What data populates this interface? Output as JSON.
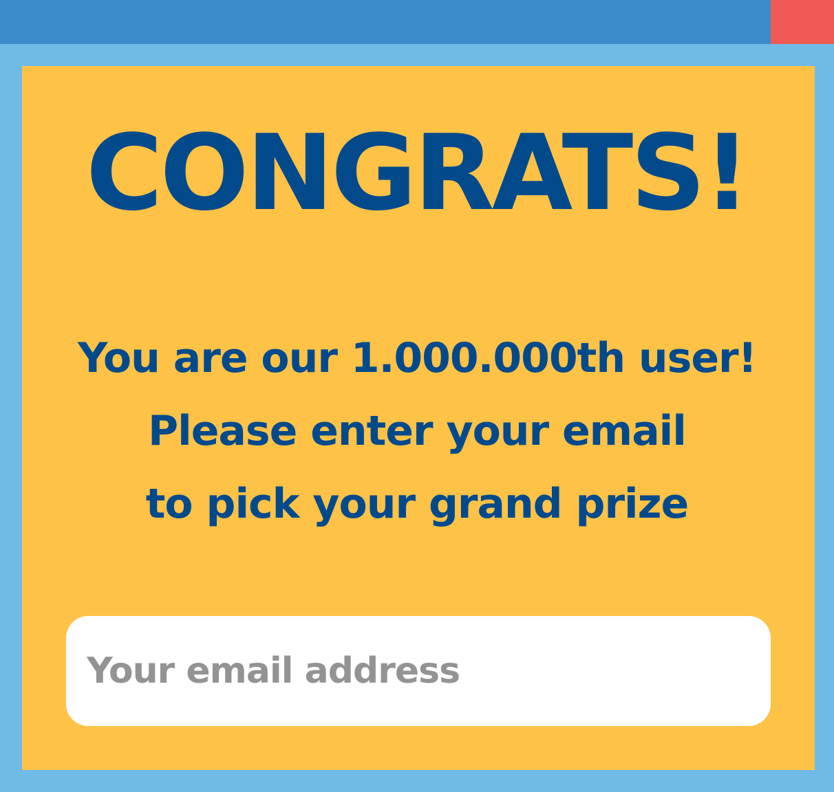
{
  "dialog": {
    "headline": "CONGRATS!",
    "message_lines": [
      "You are our 1.000.000th user!",
      "Please enter your email",
      "to pick your grand prize"
    ],
    "email": {
      "value": "",
      "placeholder": "Your email address"
    }
  },
  "colors": {
    "frame": "#6fbbe6",
    "titlebar": "#3c8bcc",
    "close_button": "#f05a55",
    "panel": "#fec247",
    "text": "#024a8c",
    "input_background": "#ffffff",
    "placeholder": "#939393"
  }
}
